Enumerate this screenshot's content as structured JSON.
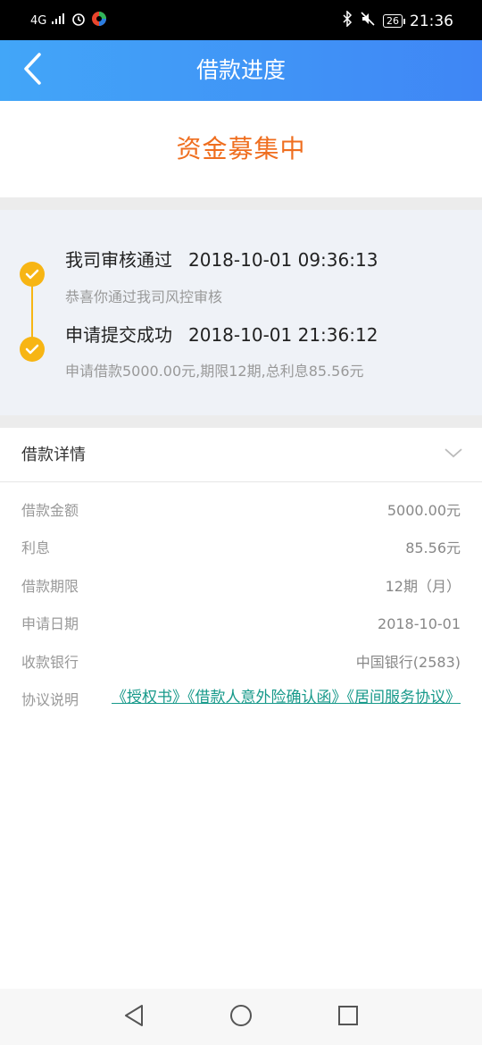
{
  "status_bar": {
    "network": "4G",
    "battery": "26",
    "time": "21:36"
  },
  "header": {
    "title": "借款进度",
    "back_icon": "chevron-left-icon"
  },
  "status_banner": {
    "text": "资金募集中",
    "color": "#ef6e1f"
  },
  "timeline": {
    "accent_color": "#f7b514",
    "steps": [
      {
        "title": "我司审核通过",
        "time": "2018-10-01 09:36:13",
        "desc": "恭喜你通过我司风控审核"
      },
      {
        "title": "申请提交成功",
        "time": "2018-10-01 21:36:12",
        "desc": "申请借款5000.00元,期限12期,总利息85.56元"
      }
    ]
  },
  "details": {
    "title": "借款详情",
    "rows": [
      {
        "label": "借款金额",
        "value": "5000.00元"
      },
      {
        "label": "利息",
        "value": "85.56元"
      },
      {
        "label": "借款期限",
        "value": "12期（月）"
      },
      {
        "label": "申请日期",
        "value": "2018-10-01"
      },
      {
        "label": "收款银行",
        "value": "中国银行(2583)"
      }
    ],
    "agreement_label": "协议说明",
    "agreements": [
      "《授权书》",
      "《借款人意外险确认函》",
      "《居间服务协议》"
    ],
    "link_color": "#17998a"
  },
  "nav_bar": {
    "back": "triangle-back-icon",
    "home": "circle-home-icon",
    "recents": "square-recents-icon"
  }
}
